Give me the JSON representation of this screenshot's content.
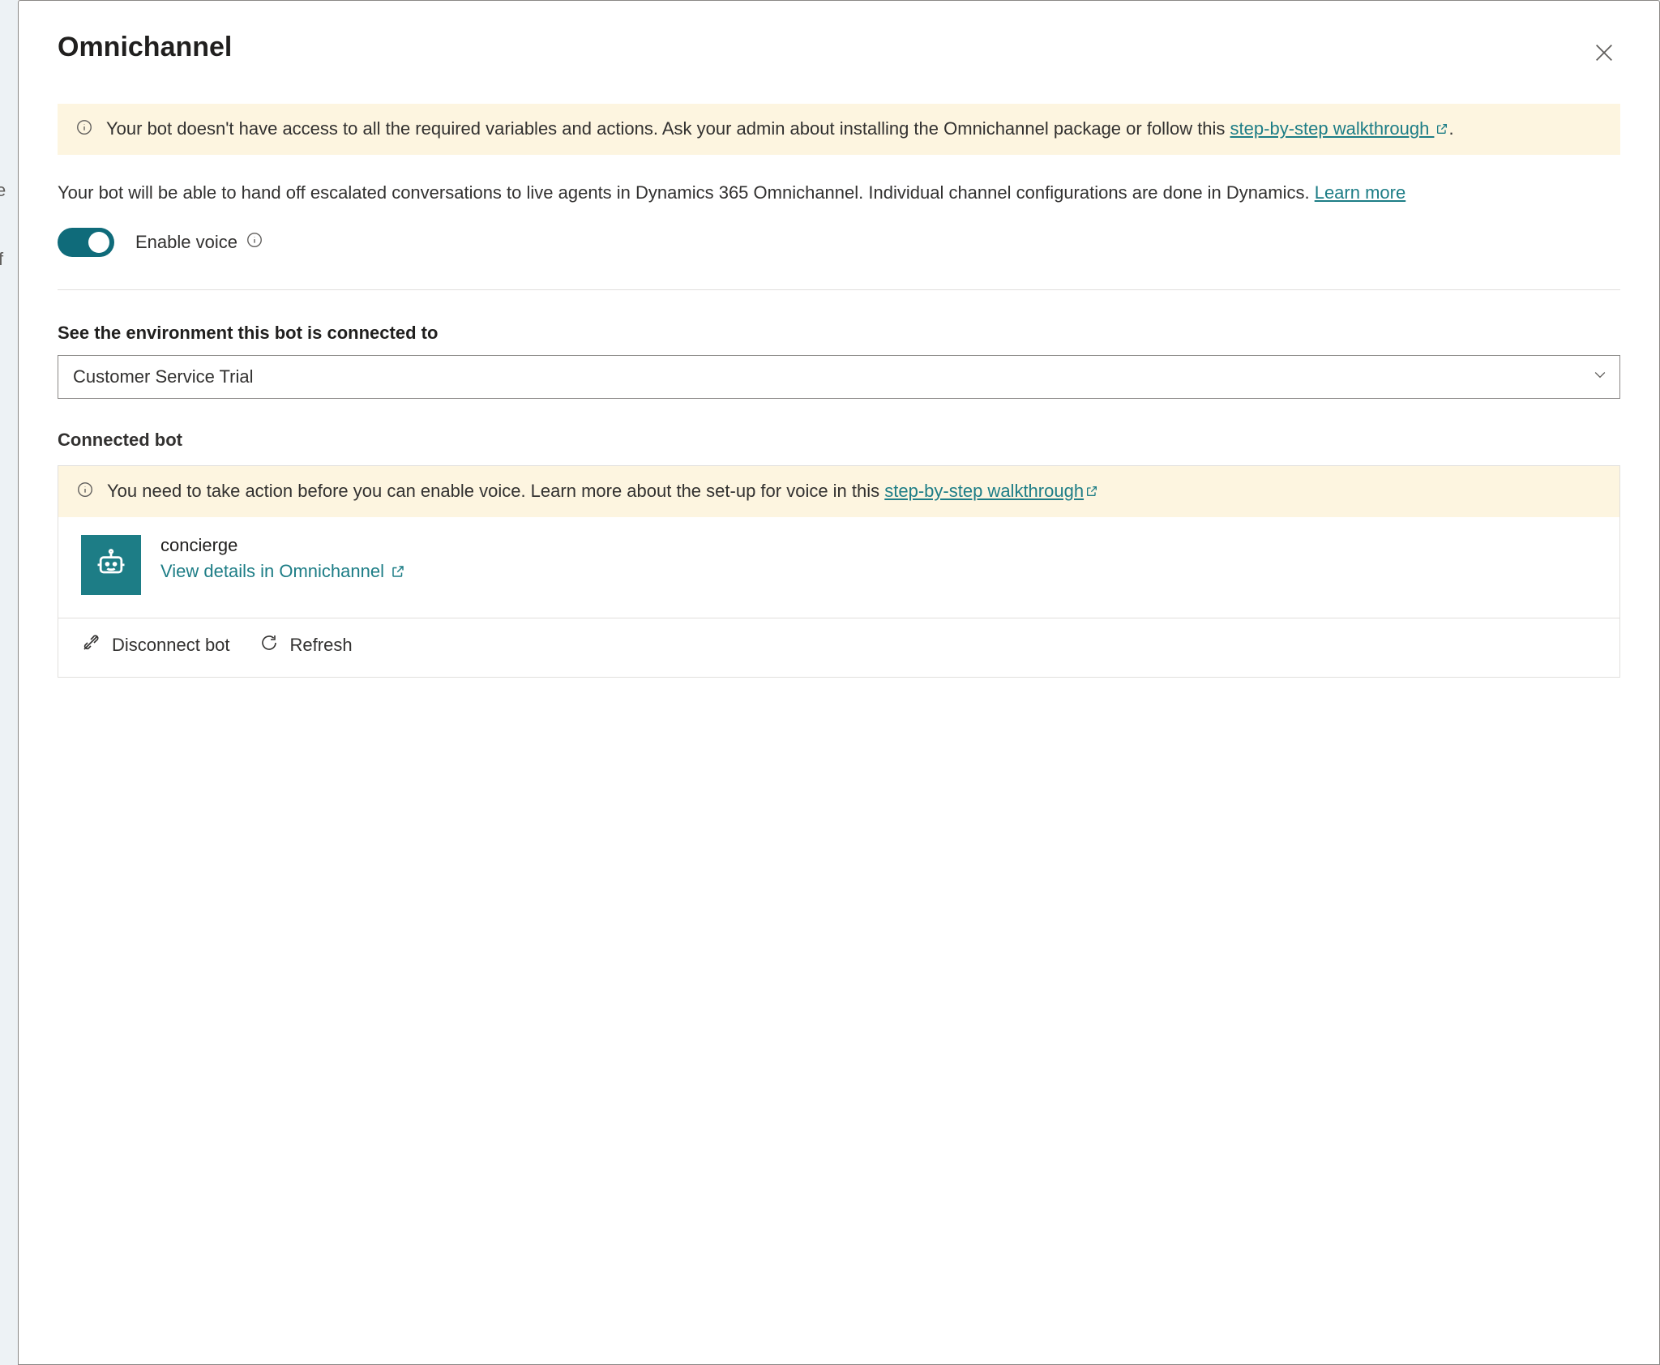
{
  "panel_title": "Omnichannel",
  "banner1": {
    "text_a": "Your bot doesn't have access to all the required variables and actions. Ask your admin about installing the Omnichannel package or follow this ",
    "link": "step-by-step walkthrough ",
    "text_b": "."
  },
  "description": {
    "text": "Your bot will be able to hand off escalated conversations to live agents in Dynamics 365 Omnichannel. Individual channel configurations are done in Dynamics. ",
    "link": "Learn more"
  },
  "toggle": {
    "label": "Enable voice",
    "on": true
  },
  "env": {
    "section_label": "See the environment this bot is connected to",
    "selected": "Customer Service Trial"
  },
  "connected": {
    "heading": "Connected bot",
    "banner": {
      "text_a": "You need to take action before you can enable voice. Learn more about the set-up for voice in this ",
      "link": "step-by-step walkthrough"
    },
    "bot_name": "concierge",
    "view_link": "View details in Omnichannel",
    "disconnect": "Disconnect bot",
    "refresh": "Refresh"
  }
}
